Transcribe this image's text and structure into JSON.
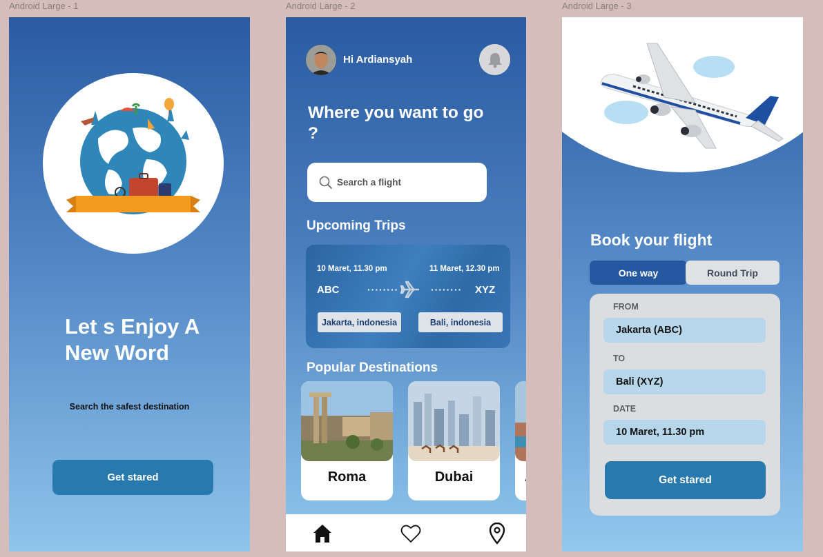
{
  "frames": [
    {
      "label": "Android Large - 1"
    },
    {
      "label": "Android Large - 2"
    },
    {
      "label": "Android Large - 3"
    }
  ],
  "screen1": {
    "title": "Let s Enjoy A New Word",
    "subtitle": "Search the safest destination",
    "cta_label": "Get stared"
  },
  "screen2": {
    "greeting": "Hi Ardiansyah",
    "heading": "Where you want to go ?",
    "search": {
      "placeholder": "Search a flight"
    },
    "upcoming_title": "Upcoming Trips",
    "trip": {
      "depart_time": "10 Maret, 11.30 pm",
      "arrive_time": "11 Maret, 12.30 pm",
      "from_code": "ABC",
      "to_code": "XYZ",
      "from_city": "Jakarta, indonesia",
      "to_city": "Bali, indonesia"
    },
    "popular_title": "Popular Destinations",
    "destinations": [
      {
        "name": "Roma"
      },
      {
        "name": "Dubai"
      },
      {
        "name": "A"
      }
    ],
    "tabbar": [
      {
        "icon": "home-icon",
        "active": true
      },
      {
        "icon": "heart-icon",
        "active": false
      },
      {
        "icon": "location-pin-icon",
        "active": false
      }
    ]
  },
  "screen3": {
    "heading": "Book your flight",
    "segments": [
      {
        "label": "One way",
        "active": true
      },
      {
        "label": "Round Trip",
        "active": false
      }
    ],
    "from_label": "FROM",
    "from_value": "Jakarta (ABC)",
    "to_label": "TO",
    "to_value": "Bali (XYZ)",
    "date_label": "DATE",
    "date_value": "10 Maret, 11.30 pm",
    "cta_label": "Get stared"
  },
  "colors": {
    "canvas": "#d5bdbb",
    "gradient_top": "#2a5ba2",
    "gradient_bottom": "#91c9ee",
    "button": "#2779ae",
    "segment_active": "#2458a0",
    "field_fill": "#b7d6ea",
    "panel": "#dcdde0"
  }
}
